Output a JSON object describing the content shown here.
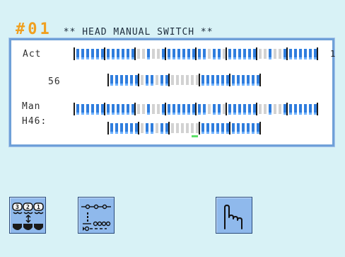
{
  "header": {
    "head_number": "#01",
    "title": "** HEAD MANUAL SWITCH **"
  },
  "panel": {
    "act_label": "Act",
    "act_value": "56",
    "man_label": "Man",
    "man_head": "H46:",
    "row_end_number": "1"
  },
  "buttons": {
    "head_select_icon": "head-group-select-icon",
    "needle_pattern_icon": "needle-pattern-icon",
    "manual_hand_icon": "hand-icon"
  },
  "colors": {
    "background": "#d8f2f6",
    "needle_on": "#2f7ddd",
    "needle_off": "#d2d2d2",
    "head_number": "#f0a020",
    "button": "#8fb9ec",
    "cursor": "#5ee06a"
  }
}
